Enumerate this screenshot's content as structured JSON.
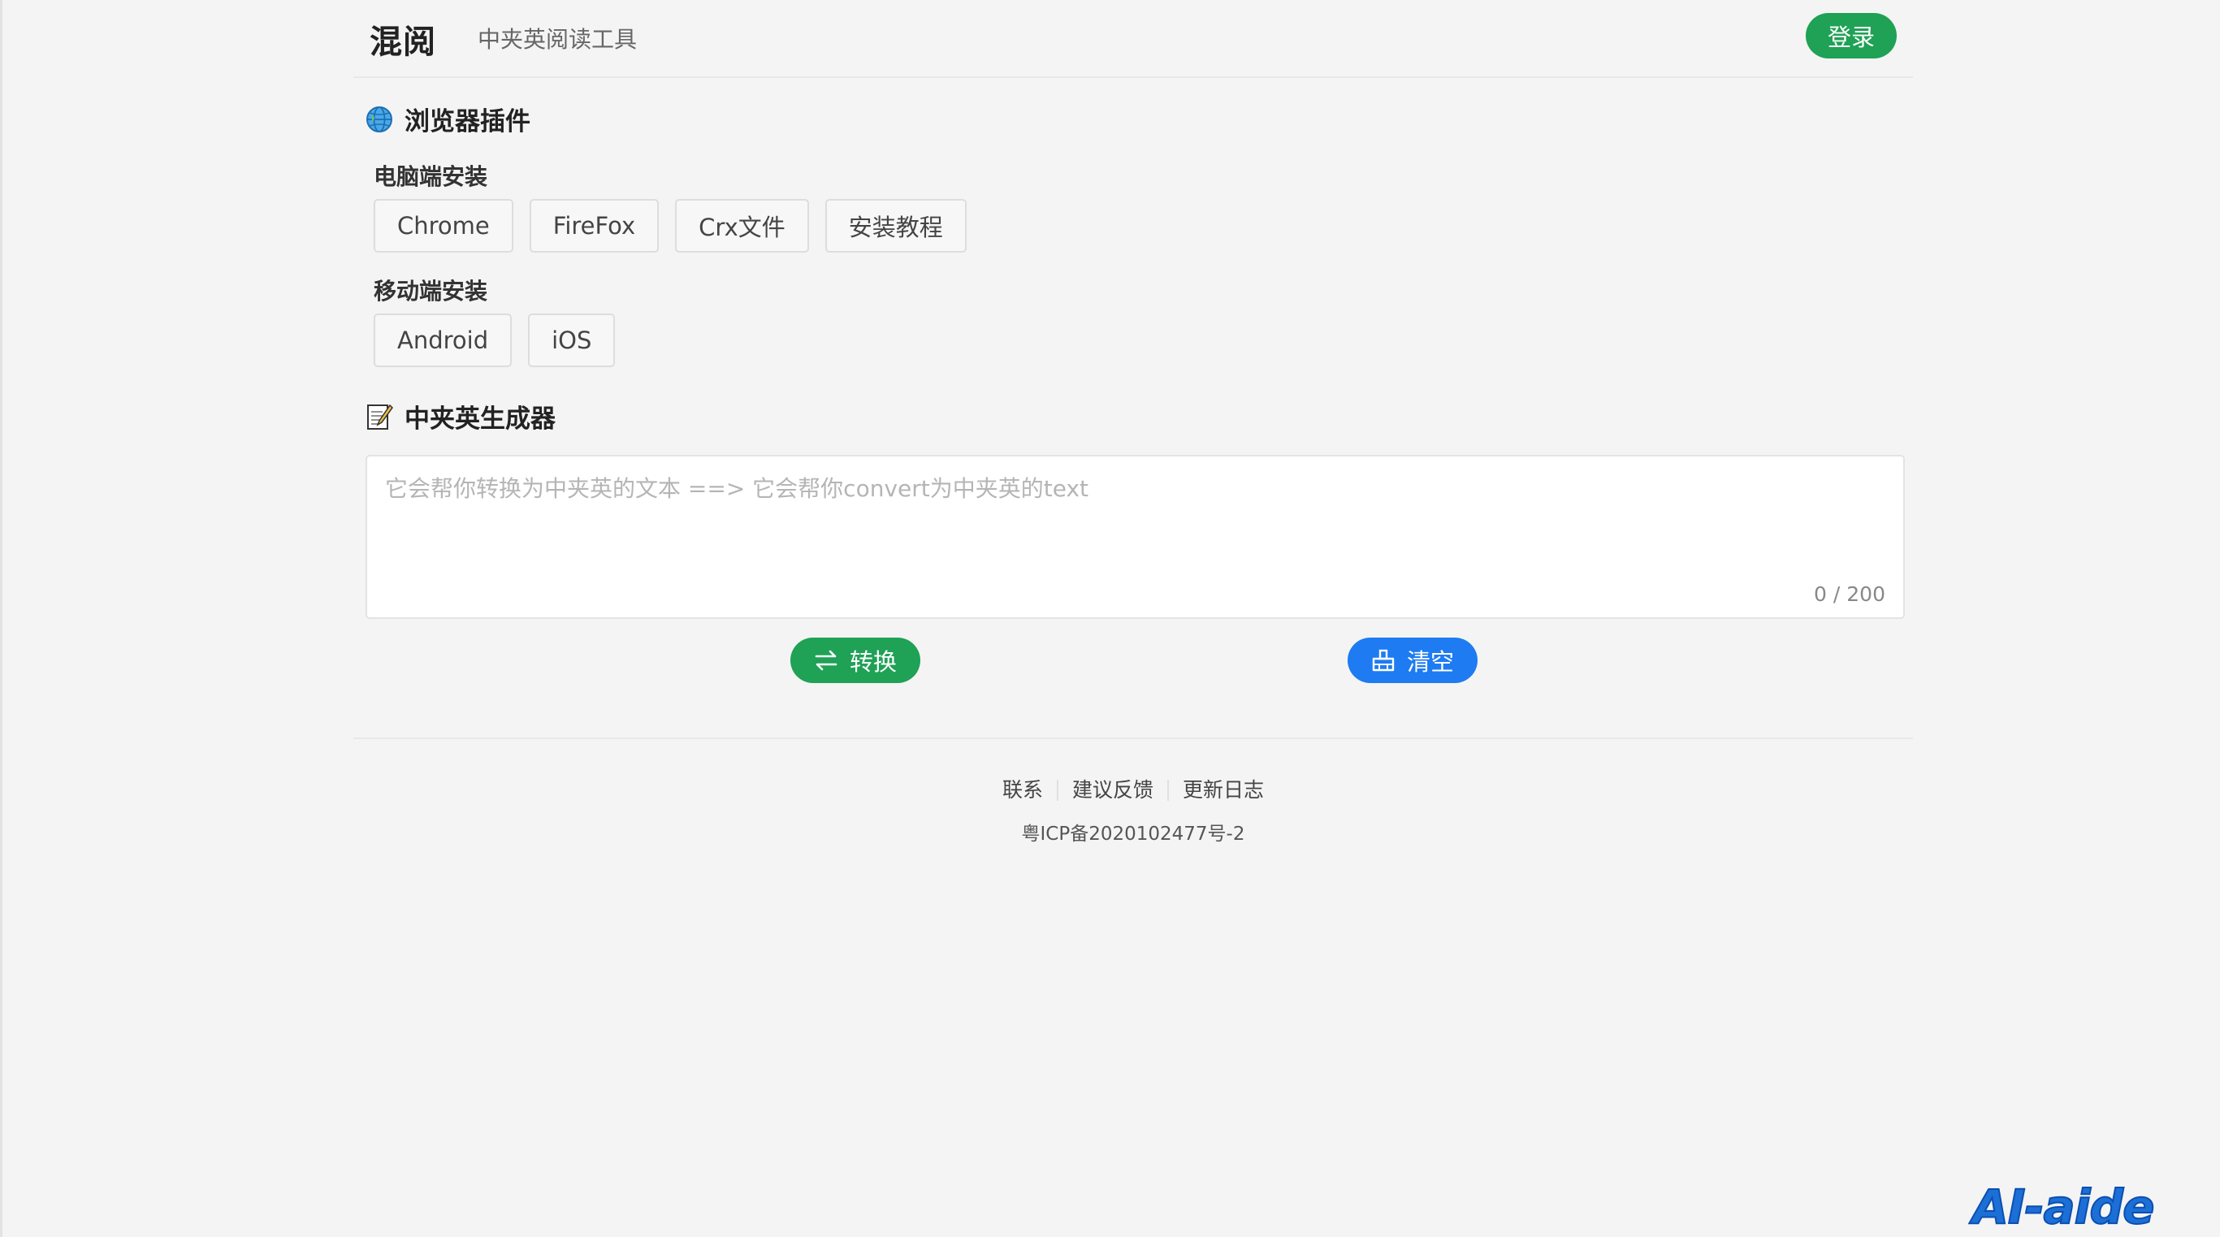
{
  "header": {
    "brand": "混阅",
    "tagline": "中夹英阅读工具",
    "login_label": "登录"
  },
  "plugin_section": {
    "title": "浏览器插件",
    "icon": "globe-icon",
    "desktop": {
      "title": "电脑端安装",
      "buttons": [
        "Chrome",
        "FireFox",
        "Crx文件",
        "安装教程"
      ]
    },
    "mobile": {
      "title": "移动端安装",
      "buttons": [
        "Android",
        "iOS"
      ]
    }
  },
  "generator_section": {
    "title": "中夹英生成器",
    "icon": "memo-icon",
    "input": {
      "placeholder": "它会帮你转换为中夹英的文本 ==> 它会帮你convert为中夹英的text",
      "value": "",
      "counter": "0 / 200"
    },
    "convert_label": "转换",
    "clear_label": "清空"
  },
  "footer": {
    "links": [
      "联系",
      "建议反馈",
      "更新日志"
    ],
    "icp": "粤ICP备2020102477号-2"
  },
  "watermark": "AI-aide",
  "colors": {
    "green": "#1fa156",
    "blue": "#1e7bf2",
    "background": "#f4f4f4"
  }
}
